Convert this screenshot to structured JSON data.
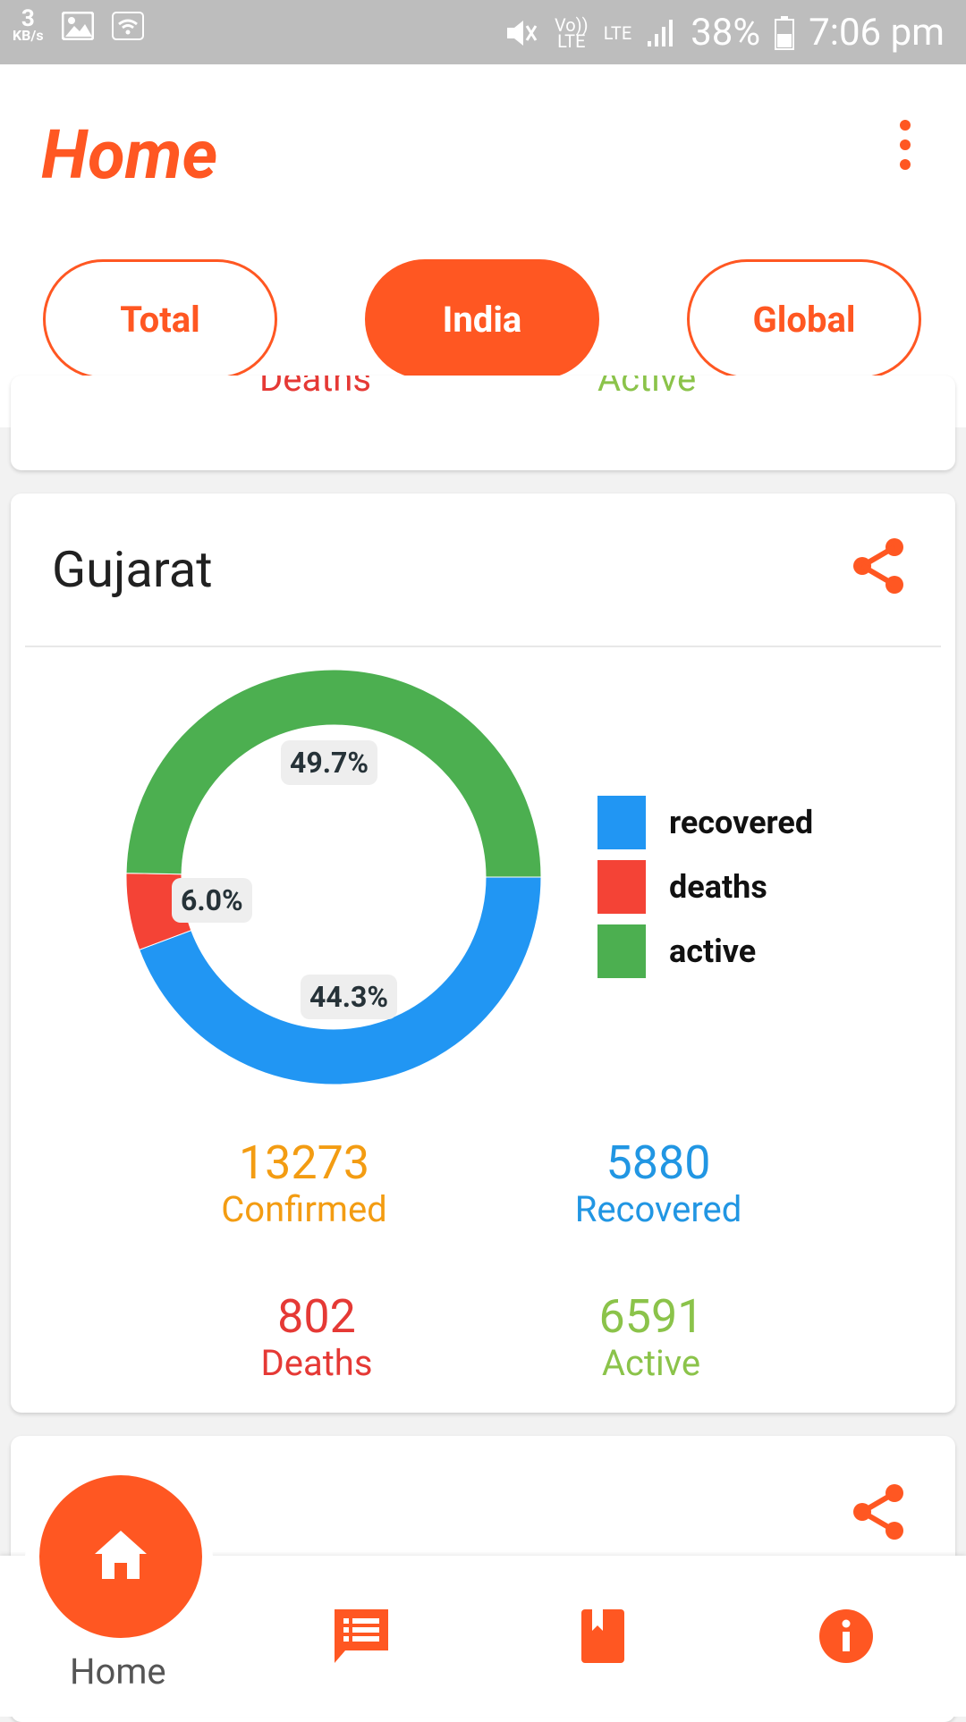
{
  "status_bar": {
    "speed_value": "3",
    "speed_unit": "KB/s",
    "volte": "Vo)) LTE",
    "lte": "LTE",
    "battery": "38%",
    "time": "7:06 pm"
  },
  "header": {
    "title": "Home",
    "tabs": [
      {
        "label": "Total"
      },
      {
        "label": "India"
      },
      {
        "label": "Global"
      }
    ],
    "active_tab": "India"
  },
  "previous_card": {
    "deaths_label": "Deaths",
    "active_label": "Active"
  },
  "card": {
    "state": "Gujarat",
    "chart_percent_labels": {
      "active": "49.7%",
      "deaths": "6.0%",
      "recovered": "44.3%"
    },
    "legend": [
      {
        "label": "recovered",
        "color": "#2196f3"
      },
      {
        "label": "deaths",
        "color": "#f44336"
      },
      {
        "label": "active",
        "color": "#4caf50"
      }
    ],
    "stats": {
      "confirmed": {
        "value": "13273",
        "label": "Confirmed",
        "color": "#f39c12"
      },
      "recovered": {
        "value": "5880",
        "label": "Recovered",
        "color": "#2196e3"
      },
      "deaths": {
        "value": "802",
        "label": "Deaths",
        "color": "#e53935"
      },
      "active": {
        "value": "6591",
        "label": "Active",
        "color": "#8bc34a"
      }
    }
  },
  "chart_data": {
    "type": "pie",
    "categories": [
      "recovered",
      "deaths",
      "active"
    ],
    "values": [
      44.3,
      6.0,
      49.7
    ],
    "colors": [
      "#2196f3",
      "#f44336",
      "#4caf50"
    ],
    "legend": "right"
  },
  "bottom_nav": {
    "home_label": "Home",
    "items": [
      "home-icon",
      "news-icon",
      "book-icon",
      "info-icon"
    ]
  },
  "accent_color": "#ff5722"
}
